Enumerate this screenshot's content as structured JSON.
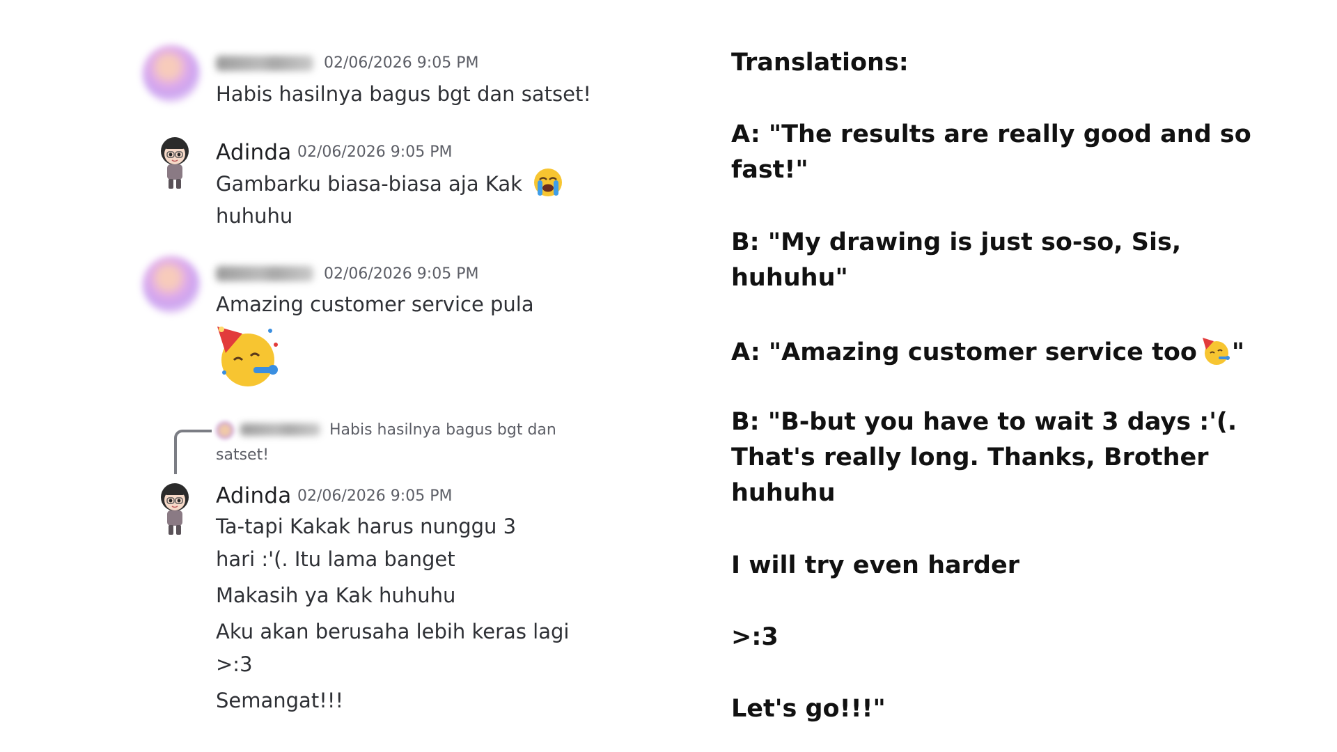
{
  "chat": {
    "messages": [
      {
        "author_blurred": true,
        "timestamp": "02/06/2026 9:05 PM",
        "lines": [
          "Habis hasilnya bagus bgt dan satset!"
        ]
      },
      {
        "author": "Adinda",
        "timestamp": "02/06/2026 9:05 PM",
        "lines": [
          "Gambarku biasa-biasa aja Kak",
          "huhuhu"
        ],
        "emoji": "loudly-crying-face"
      },
      {
        "author_blurred": true,
        "timestamp": "02/06/2026 9:05 PM",
        "lines": [
          "Amazing customer service pula"
        ],
        "emoji": "partying-face"
      },
      {
        "reply_preview": {
          "line1": "Habis hasilnya bagus bgt dan",
          "line2": "satset!"
        },
        "author": "Adinda",
        "timestamp": "02/06/2026 9:05 PM",
        "lines": [
          "Ta-tapi Kakak harus nunggu 3",
          "hari :'(. Itu lama banget",
          "Makasih ya Kak huhuhu",
          "Aku akan berusaha lebih keras lagi",
          ">:3",
          "Semangat!!!"
        ]
      }
    ]
  },
  "translations": {
    "heading": "Translations:",
    "lines": [
      "A: \"The results are really good and so",
      "fast!\"",
      "B: \"My drawing is just so-so, Sis,",
      "huhuhu\"",
      "A: \"Amazing customer service too",
      "\"",
      "B: \"B-but you have to wait 3 days :'(.",
      "That's really long. Thanks, Brother",
      "huhuhu",
      "I will try even harder",
      ">:3",
      "Let's go!!!\""
    ],
    "emoji": "partying-face"
  },
  "colors": {
    "text": "#2e3035",
    "timestamp": "#5c5e66",
    "heading_text": "#111111",
    "reply_line": "#7b7d84"
  }
}
